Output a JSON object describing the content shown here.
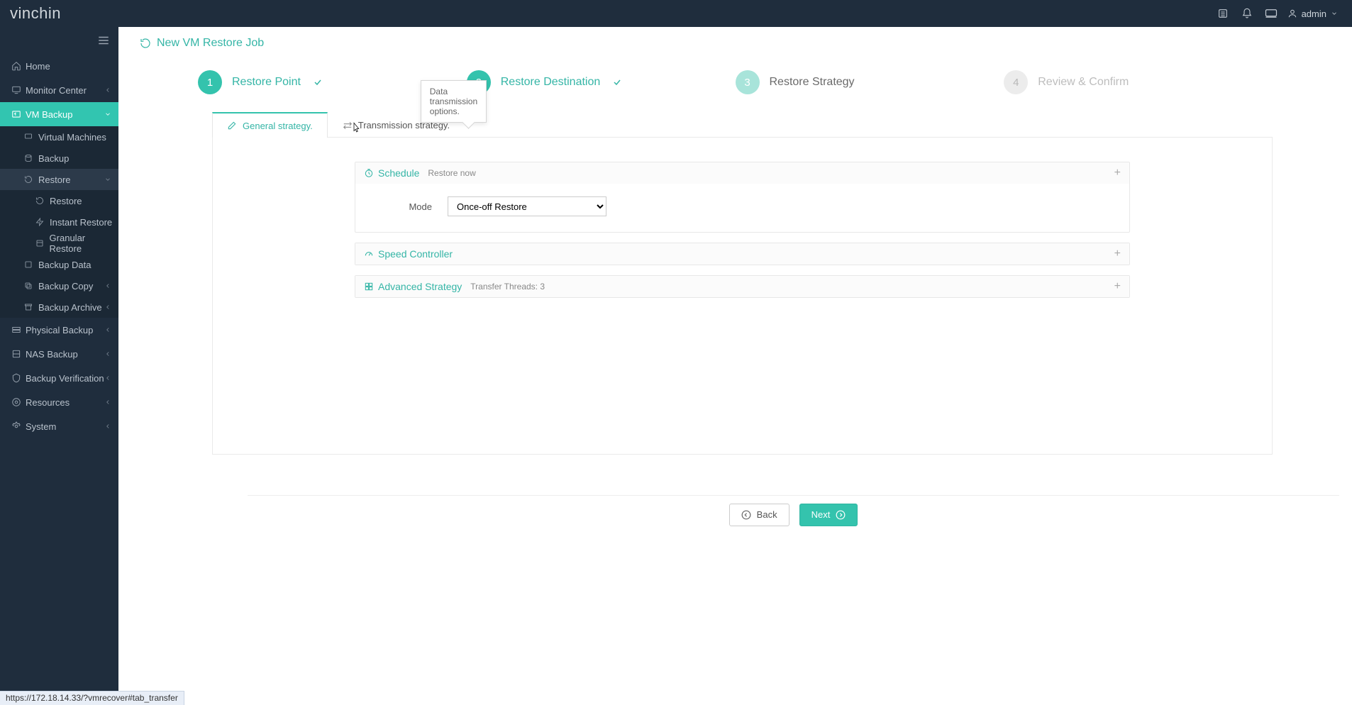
{
  "brand": {
    "pre": "vin",
    "post": "chin"
  },
  "topbar": {
    "user": "admin"
  },
  "sidebar": {
    "items": [
      {
        "label": "Home"
      },
      {
        "label": "Monitor Center"
      },
      {
        "label": "VM Backup"
      },
      {
        "label": "Virtual Machines"
      },
      {
        "label": "Backup"
      },
      {
        "label": "Restore"
      },
      {
        "label": "Restore"
      },
      {
        "label": "Instant Restore"
      },
      {
        "label": "Granular Restore"
      },
      {
        "label": "Backup Data"
      },
      {
        "label": "Backup Copy"
      },
      {
        "label": "Backup Archive"
      },
      {
        "label": "Physical Backup"
      },
      {
        "label": "NAS Backup"
      },
      {
        "label": "Backup Verification"
      },
      {
        "label": "Resources"
      },
      {
        "label": "System"
      }
    ]
  },
  "page": {
    "title": "New VM Restore Job"
  },
  "wizard": {
    "steps": [
      {
        "num": "1",
        "label": "Restore Point"
      },
      {
        "num": "2",
        "label": "Restore Destination"
      },
      {
        "num": "3",
        "label": "Restore Strategy"
      },
      {
        "num": "4",
        "label": "Review & Confirm"
      }
    ],
    "tabs": {
      "general": "General strategy.",
      "transmission": "Transmission strategy."
    },
    "tooltip": "Data transmission options.",
    "schedule": {
      "title": "Schedule",
      "subtitle": "Restore now",
      "mode_label": "Mode",
      "mode_value": "Once-off Restore"
    },
    "speed": {
      "title": "Speed Controller"
    },
    "advanced": {
      "title": "Advanced Strategy",
      "subtitle": "Transfer Threads: 3"
    },
    "back": "Back",
    "next": "Next"
  },
  "statusbar": "https://172.18.14.33/?vmrecover#tab_transfer"
}
